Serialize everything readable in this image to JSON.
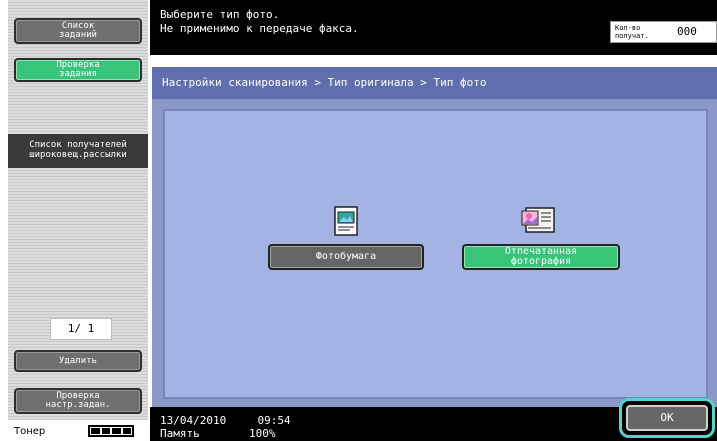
{
  "left_panel": {
    "job_list_button": [
      "Список",
      "заданий"
    ],
    "job_check_button": [
      "Проверка",
      "задания"
    ],
    "recipients_header": [
      "Список получателей",
      "широковещ.рассылки"
    ],
    "pager": "1/ 1",
    "delete_button": "Удалить",
    "check_settings_button": [
      "Проверка",
      "настр.задан."
    ],
    "toner_label": "Тонер"
  },
  "top_bar": {
    "message": [
      "Выберите тип фото.",
      "Не применимо к передаче факса."
    ],
    "count_label": [
      "Кол-во",
      "получат."
    ],
    "count_value": "000"
  },
  "breadcrumb": "Настройки сканирования > Тип оригинала > Тип фото",
  "options": {
    "photo_paper": "Фотобумага",
    "printed_photo": [
      "Отпечатанная",
      "фотография"
    ]
  },
  "status_bar": {
    "date": "13/04/2010",
    "time": "09:54",
    "memory_label": "Память",
    "memory_value": "100%"
  },
  "ok_button": "OK",
  "colors": {
    "accent_green": "#38c57a",
    "panel_blue": "#8a98c8",
    "highlight_cyan": "#4cd7cf"
  }
}
